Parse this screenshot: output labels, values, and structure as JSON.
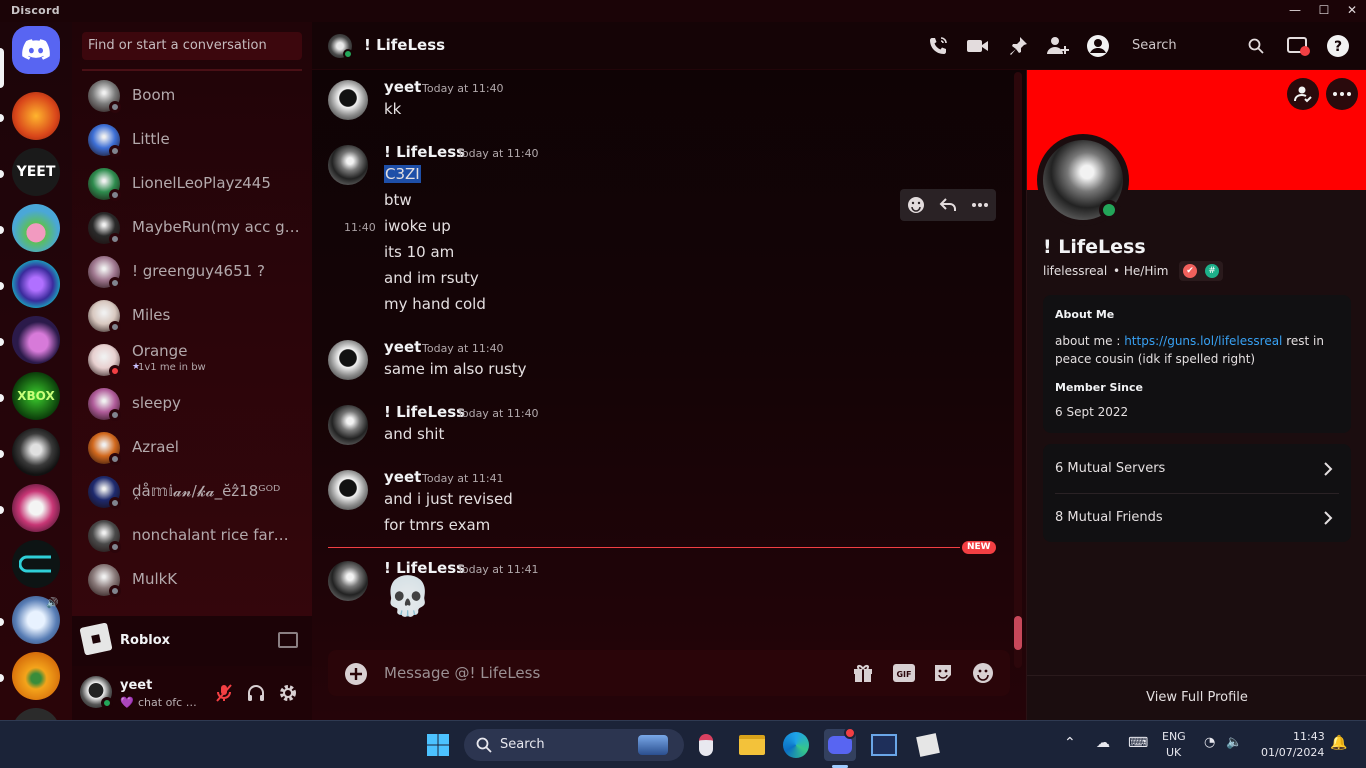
{
  "window": {
    "app_title": "Discord",
    "minimize": "—",
    "maximize": "☐",
    "close": "✕"
  },
  "servers": [
    {
      "name": "Discord Home",
      "color": "#5865f2"
    },
    {
      "name": "server-fire",
      "color": "#d9461a"
    },
    {
      "name": "server-yeet",
      "color": "#222222",
      "label": "YEET"
    },
    {
      "name": "server-kirby",
      "color": "#4aa7d8"
    },
    {
      "name": "server-purple-crest",
      "color": "#6a2ca0"
    },
    {
      "name": "server-mewtwo",
      "color": "#2b1a4a"
    },
    {
      "name": "server-xbox",
      "color": "#0e7a0d",
      "label": "XBOX"
    },
    {
      "name": "server-dark-figure",
      "color": "#3a3a3a"
    },
    {
      "name": "server-pink-character",
      "color": "#c73675"
    },
    {
      "name": "server-c-logo",
      "color": "#0d1414"
    },
    {
      "name": "server-cloud",
      "color": "#587db5"
    },
    {
      "name": "server-yellow-face",
      "color": "#f4a41b"
    }
  ],
  "dm": {
    "search_placeholder": "Find or start a conversation",
    "items": [
      {
        "name": "Boom",
        "avatar_color": "#7a7a7a",
        "status": "offline"
      },
      {
        "name": "Little",
        "avatar_color": "#3d6fd6",
        "status": "offline"
      },
      {
        "name": "LionelLeoPlayz445",
        "avatar_color": "#2e8c4e",
        "status": "offline"
      },
      {
        "name": "MaybeRun(my acc got…",
        "avatar_color": "#2a2a2a",
        "status": "offline"
      },
      {
        "name": "! greenguy4651 ?",
        "avatar_color": "#a07890",
        "status": "offline"
      },
      {
        "name": "Miles",
        "avatar_color": "#d8c8c0",
        "status": "offline"
      },
      {
        "name": "Orange",
        "avatar_color": "#e8d0d0",
        "status": "dnd",
        "sub": "1v1 me in bw"
      },
      {
        "name": "sleepy",
        "avatar_color": "#b05c9a",
        "status": "offline"
      },
      {
        "name": "Azrael",
        "avatar_color": "#d2691e",
        "status": "offline"
      },
      {
        "name": "ḓå𝕞𝕚𝓪𝓷/𝓴𝓪_ĕẑ18ᴳᴼᴰ",
        "avatar_color": "#1e2a6e",
        "status": "offline"
      },
      {
        "name": "nonchalant rice farmer",
        "avatar_color": "#4a4a4a",
        "status": "offline"
      },
      {
        "name": "MulkK",
        "avatar_color": "#8a7a7a",
        "status": "offline"
      }
    ]
  },
  "activity": {
    "game": "Roblox"
  },
  "user_panel": {
    "name": "yeet",
    "custom_status": "chat ofc …"
  },
  "chat": {
    "channel_name": "! LifeLess",
    "header_search": "Search",
    "new_label": "NEW",
    "composer_placeholder": "Message @! LifeLess",
    "hover_time": "11:40",
    "messages": [
      {
        "author": "yeet",
        "time": "Today at 11:40",
        "lines": [
          "kk"
        ]
      },
      {
        "author": "! LifeLess",
        "time": "Today at 11:40",
        "lines": [
          "C3ZI",
          "btw",
          "iwoke up",
          "its 10 am",
          "and im rsuty",
          "my hand cold"
        ]
      },
      {
        "author": "yeet",
        "time": "Today at 11:40",
        "lines": [
          "same im also rusty"
        ]
      },
      {
        "author": "! LifeLess",
        "time": "Today at 11:40",
        "lines": [
          "and shit"
        ]
      },
      {
        "author": "yeet",
        "time": "Today at 11:41",
        "lines": [
          "and i just revised",
          "for tmrs exam"
        ]
      },
      {
        "author": "! LifeLess",
        "time": "Today at 11:41",
        "lines": [
          "💀"
        ]
      }
    ]
  },
  "profile": {
    "display_name": "! LifeLess",
    "username": "lifelessreal",
    "pronouns": "• He/Him",
    "banner_color": "#ff0000",
    "about_me_heading": "About Me",
    "about_prefix": "about me : ",
    "about_link": "https://guns.lol/lifelessreal",
    "about_suffix": " rest in peace cousin (idk if spelled right)",
    "member_since_heading": "Member Since",
    "member_since": "6 Sept 2022",
    "mutual_servers": "6 Mutual Servers",
    "mutual_friends": "8 Mutual Friends",
    "view_full": "View Full Profile"
  },
  "taskbar": {
    "search": "Search",
    "lang_top": "ENG",
    "lang_bottom": "UK",
    "time": "11:43",
    "date": "01/07/2024"
  }
}
